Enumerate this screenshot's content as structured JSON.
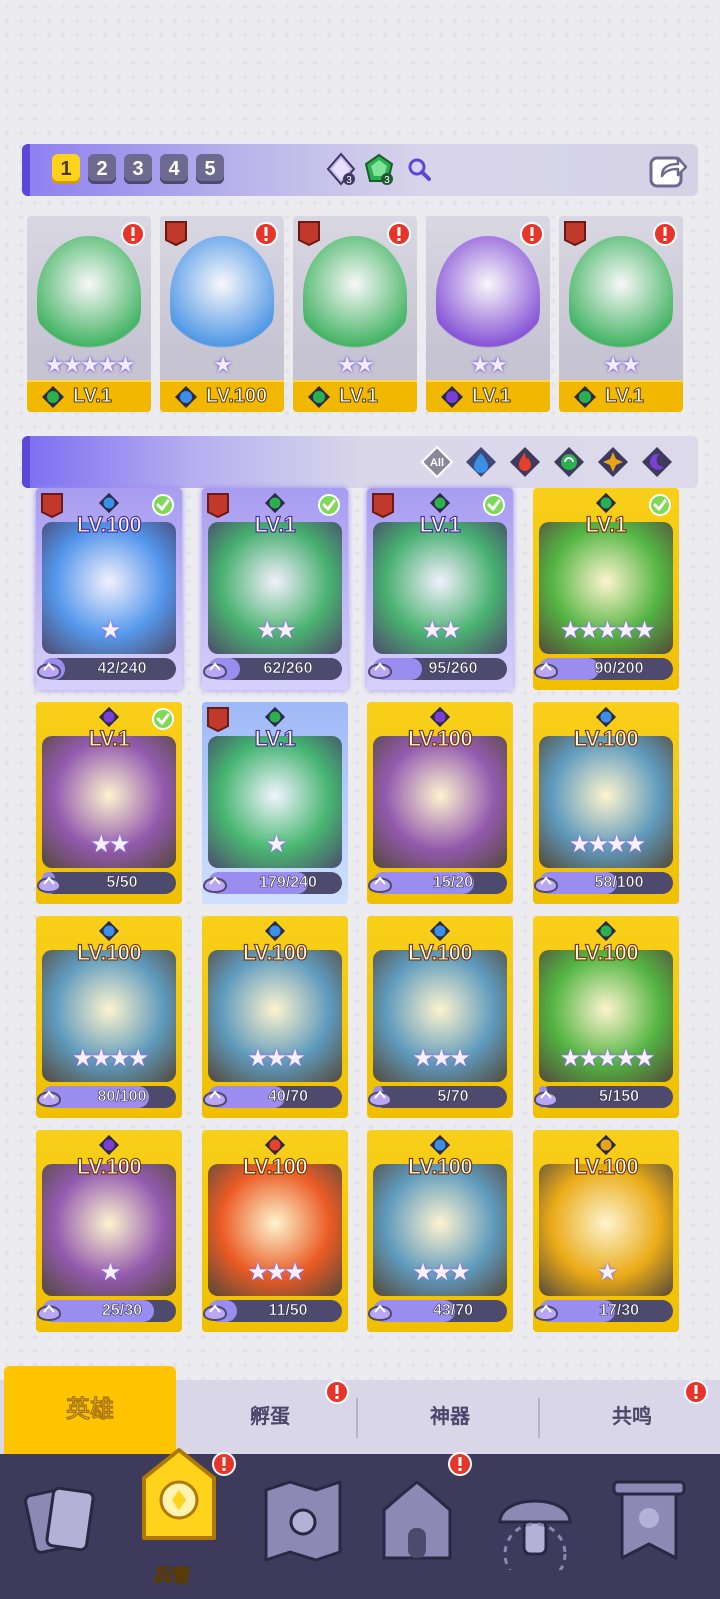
{
  "team": {
    "slots": [
      "1",
      "2",
      "3",
      "4",
      "5"
    ],
    "active_slot": "1",
    "gem1_count": "3",
    "gem2_count": "3",
    "heroes": [
      {
        "level": "LV.1",
        "element": "nature",
        "stars": "★★★★★",
        "rank": "",
        "alert": true
      },
      {
        "level": "LV.100",
        "element": "water",
        "stars": "★",
        "rank": "IV",
        "alert": true
      },
      {
        "level": "LV.1",
        "element": "nature",
        "stars": "★★",
        "rank": "IV",
        "alert": true
      },
      {
        "level": "LV.1",
        "element": "dark",
        "stars": "★★",
        "rank": "",
        "alert": true
      },
      {
        "level": "LV.1",
        "element": "nature",
        "stars": "★★",
        "rank": "III",
        "alert": true
      }
    ]
  },
  "filters": {
    "all_label": "All",
    "items": [
      "all-icon",
      "water-icon",
      "fire-icon",
      "nature-icon",
      "light-icon",
      "dark-icon"
    ]
  },
  "heroes": [
    {
      "level": "LV.100",
      "element": "water",
      "rank": "IV",
      "check": true,
      "stars": "★",
      "shards": "42/240",
      "fill": 0.175,
      "style": "purple"
    },
    {
      "level": "LV.1",
      "element": "nature",
      "rank": "IV",
      "check": true,
      "stars": "★★",
      "shards": "62/260",
      "fill": 0.238,
      "style": "purple"
    },
    {
      "level": "LV.1",
      "element": "nature",
      "rank": "III",
      "check": true,
      "stars": "★★",
      "shards": "95/260",
      "fill": 0.365,
      "style": "purple"
    },
    {
      "level": "LV.1",
      "element": "nature",
      "rank": "",
      "check": true,
      "stars": "★★★★★",
      "shards": "90/200",
      "fill": 0.45,
      "style": "gold"
    },
    {
      "level": "LV.1",
      "element": "dark",
      "rank": "",
      "check": true,
      "stars": "★★",
      "shards": "5/50",
      "fill": 0.1,
      "style": "gold"
    },
    {
      "level": "LV.1",
      "element": "nature",
      "rank": "III",
      "check": false,
      "stars": "★",
      "shards": "179/240",
      "fill": 0.746,
      "style": "blue"
    },
    {
      "level": "LV.100",
      "element": "dark",
      "rank": "",
      "check": false,
      "stars": "",
      "shards": "15/20",
      "fill": 0.75,
      "style": "gold"
    },
    {
      "level": "LV.100",
      "element": "water",
      "rank": "",
      "check": false,
      "stars": "★★★★",
      "shards": "58/100",
      "fill": 0.58,
      "style": "gold"
    },
    {
      "level": "LV.100",
      "element": "water",
      "rank": "",
      "check": false,
      "stars": "★★★★",
      "shards": "80/100",
      "fill": 0.8,
      "style": "gold"
    },
    {
      "level": "LV.100",
      "element": "water",
      "rank": "",
      "check": false,
      "stars": "★★★",
      "shards": "40/70",
      "fill": 0.571,
      "style": "gold"
    },
    {
      "level": "LV.100",
      "element": "water",
      "rank": "",
      "check": false,
      "stars": "★★★",
      "shards": "5/70",
      "fill": 0.071,
      "style": "gold"
    },
    {
      "level": "LV.100",
      "element": "nature",
      "rank": "",
      "check": false,
      "stars": "★★★★★",
      "shards": "5/150",
      "fill": 0.033,
      "style": "gold"
    },
    {
      "level": "LV.100",
      "element": "dark",
      "rank": "",
      "check": false,
      "stars": "★",
      "shards": "25/30",
      "fill": 0.833,
      "style": "gold"
    },
    {
      "level": "LV.100",
      "element": "fire",
      "rank": "",
      "check": false,
      "stars": "★★★",
      "shards": "11/50",
      "fill": 0.22,
      "style": "gold"
    },
    {
      "level": "LV.100",
      "element": "water",
      "rank": "",
      "check": false,
      "stars": "★★★",
      "shards": "43/70",
      "fill": 0.614,
      "style": "gold"
    },
    {
      "level": "LV.100",
      "element": "light",
      "rank": "",
      "check": false,
      "stars": "★",
      "shards": "17/30",
      "fill": 0.567,
      "style": "gold"
    }
  ],
  "tabs": [
    {
      "label": "英雄",
      "active": true,
      "alert": false
    },
    {
      "label": "孵蛋",
      "active": false,
      "alert": true
    },
    {
      "label": "神器",
      "active": false,
      "alert": false
    },
    {
      "label": "共鸣",
      "active": false,
      "alert": true
    }
  ],
  "nav": {
    "active_label": "兵营",
    "items": [
      "cards-icon",
      "barracks-icon",
      "map-icon",
      "castle-icon",
      "mushroom-icon",
      "banner-icon"
    ]
  },
  "colors": {
    "water": "#3a8fe8",
    "fire": "#e8402a",
    "nature": "#2bb04f",
    "dark": "#7b3fd6",
    "light": "#e8a41a",
    "gold": "#f2c000",
    "accent": "#5b48d8"
  }
}
